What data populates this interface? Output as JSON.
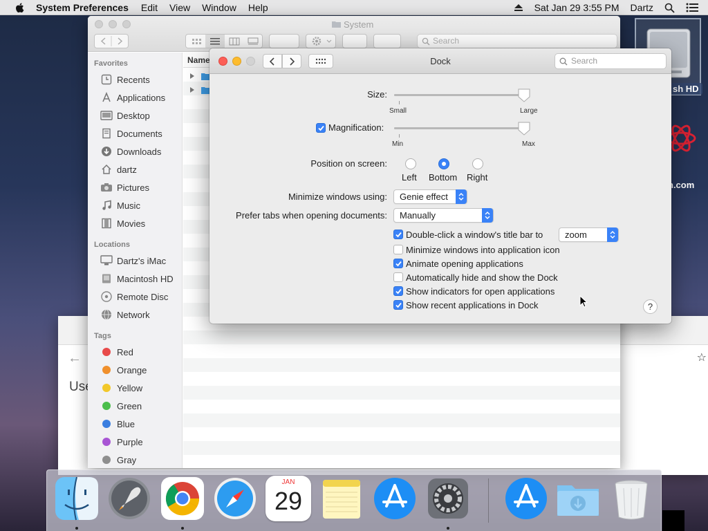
{
  "menubar": {
    "app_name": "System Preferences",
    "items": [
      "Edit",
      "View",
      "Window",
      "Help"
    ],
    "datetime": "Sat Jan 29  3:55 PM",
    "user": "Dartz"
  },
  "desktop": {
    "hd_label": "sh HD",
    "partial_text": "n.com"
  },
  "finder": {
    "title": "System",
    "search_placeholder": "Search",
    "column_header": "Name",
    "favorites_heading": "Favorites",
    "favorites": [
      "Recents",
      "Applications",
      "Desktop",
      "Documents",
      "Downloads",
      "dartz",
      "Pictures",
      "Music",
      "Movies"
    ],
    "locations_heading": "Locations",
    "locations": [
      "Dartz's iMac",
      "Macintosh HD",
      "Remote Disc",
      "Network"
    ],
    "tags_heading": "Tags",
    "tags": [
      {
        "name": "Red",
        "color": "#e84a4a"
      },
      {
        "name": "Orange",
        "color": "#f0902c"
      },
      {
        "name": "Yellow",
        "color": "#f2c82a"
      },
      {
        "name": "Green",
        "color": "#4bbe4b"
      },
      {
        "name": "Blue",
        "color": "#3a7ee0"
      },
      {
        "name": "Purple",
        "color": "#a855d4"
      },
      {
        "name": "Gray",
        "color": "#8e8e8e"
      }
    ]
  },
  "browser": {
    "heading_partial": "Use"
  },
  "dock_prefs": {
    "title": "Dock",
    "search_placeholder": "Search",
    "size_label": "Size:",
    "size_min": "Small",
    "size_max": "Large",
    "size_value": 1.0,
    "magnification_label": "Magnification:",
    "magnification_checked": true,
    "magnification_min": "Min",
    "magnification_max": "Max",
    "magnification_value": 1.0,
    "position_label": "Position on screen:",
    "positions": [
      "Left",
      "Bottom",
      "Right"
    ],
    "position_selected": "Bottom",
    "minimize_label": "Minimize windows using:",
    "minimize_value": "Genie effect",
    "prefer_tabs_label": "Prefer tabs when opening documents:",
    "prefer_tabs_value": "Manually",
    "double_click_label": "Double-click a window's title bar to",
    "double_click_checked": true,
    "double_click_value": "zoom",
    "checkboxes": [
      {
        "label": "Minimize windows into application icon",
        "checked": false
      },
      {
        "label": "Animate opening applications",
        "checked": true
      },
      {
        "label": "Automatically hide and show the Dock",
        "checked": false
      },
      {
        "label": "Show indicators for open applications",
        "checked": true
      },
      {
        "label": "Show recent applications in Dock",
        "checked": true
      }
    ],
    "help": "?"
  },
  "dock": {
    "calendar_month": "JAN",
    "calendar_day": "29",
    "apps": [
      "finder",
      "launchpad",
      "chrome",
      "safari",
      "calendar",
      "notes",
      "app-store",
      "system-preferences",
      "app-store-recent",
      "downloads",
      "trash"
    ]
  },
  "colors": {
    "accent": "#3a82f7",
    "close": "#fc5f57",
    "minimize": "#fdbc2e"
  }
}
